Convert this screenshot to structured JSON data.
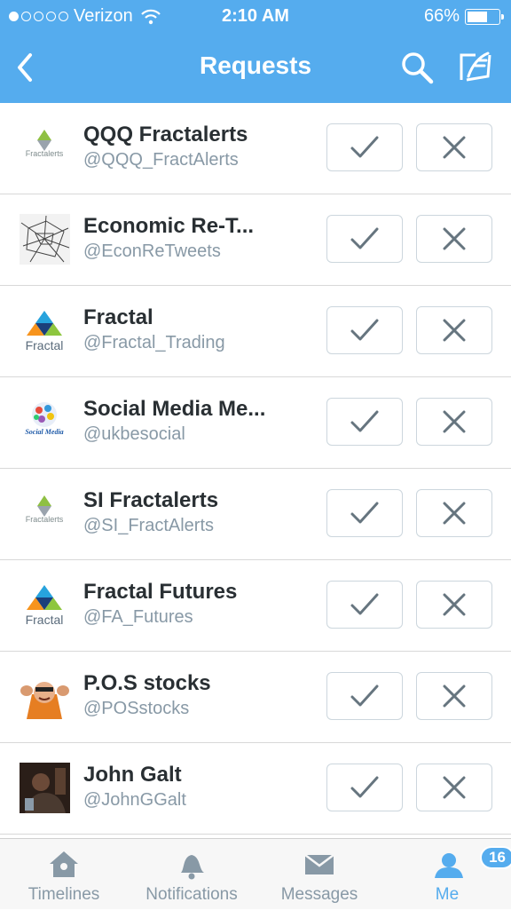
{
  "status_bar": {
    "carrier": "Verizon",
    "time": "2:10 AM",
    "battery": "66%",
    "battery_level": 0.66
  },
  "navbar": {
    "title": "Requests"
  },
  "colors": {
    "accent": "#55acee",
    "text": "#292f33",
    "muted": "#8899a6",
    "border": "#ccd6dd"
  },
  "requests": [
    {
      "name": "QQQ Fractalerts",
      "handle": "@QQQ_FractAlerts",
      "avatar_icon": "fractalerts-logo-icon",
      "avatar_text": "Fractalerts"
    },
    {
      "name": "Economic Re-T...",
      "handle": "@EconReTweets",
      "avatar_icon": "cracked-glass-icon"
    },
    {
      "name": "Fractal",
      "handle": "@Fractal_Trading",
      "avatar_icon": "fractal-logo-icon",
      "avatar_text": "Fractal"
    },
    {
      "name": "Social Media Me...",
      "handle": "@ukbesocial",
      "avatar_icon": "social-media-logo-icon",
      "avatar_text": "Social Media"
    },
    {
      "name": "SI Fractalerts",
      "handle": "@SI_FractAlerts",
      "avatar_icon": "fractalerts-logo-icon",
      "avatar_text": "Fractalerts"
    },
    {
      "name": "Fractal Futures",
      "handle": "@FA_Futures",
      "avatar_icon": "fractal-logo-icon",
      "avatar_text": "Fractal"
    },
    {
      "name": "P.O.S stocks",
      "handle": "@POSstocks",
      "avatar_icon": "cartoon-character-icon"
    },
    {
      "name": "John Galt",
      "handle": "@JohnGGalt",
      "avatar_icon": "photo-icon"
    }
  ],
  "tabs": [
    {
      "label": "Timelines",
      "icon": "home-icon"
    },
    {
      "label": "Notifications",
      "icon": "bell-icon"
    },
    {
      "label": "Messages",
      "icon": "envelope-icon"
    },
    {
      "label": "Me",
      "icon": "person-icon",
      "badge": "16",
      "active": true
    }
  ]
}
